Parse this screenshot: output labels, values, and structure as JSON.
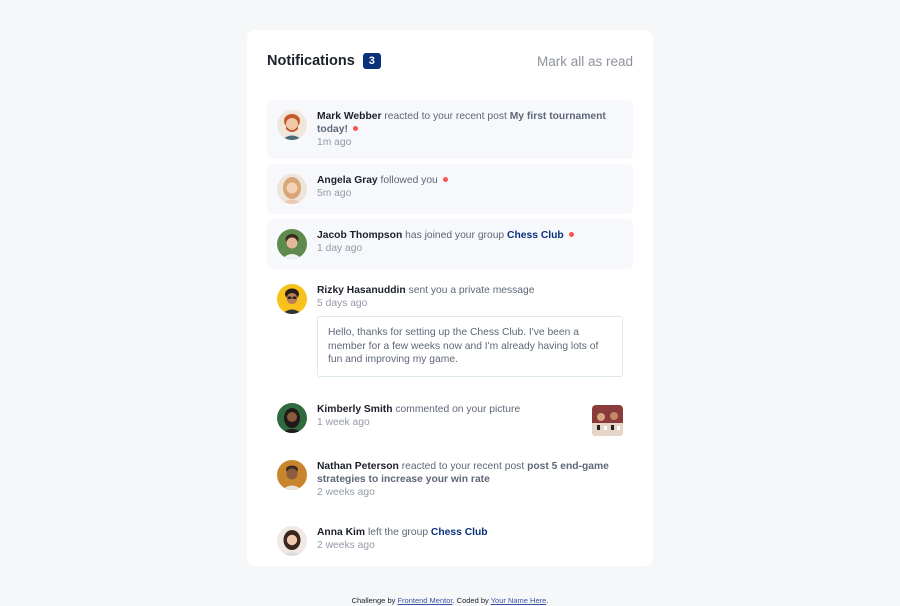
{
  "header": {
    "title": "Notifications",
    "count": "3",
    "mark_all_label": "Mark all as read"
  },
  "notifications": [
    {
      "actor": "Mark Webber",
      "action": "reacted to your recent post",
      "target": "My first tournament today!",
      "time": "1m ago",
      "unread": true
    },
    {
      "actor": "Angela Gray",
      "action": "followed you",
      "time": "5m ago",
      "unread": true
    },
    {
      "actor": "Jacob Thompson",
      "action": "has joined your group",
      "target": "Chess Club",
      "time": "1 day ago",
      "unread": true
    },
    {
      "actor": "Rizky Hasanuddin",
      "action": "sent you a private message",
      "time": "5 days ago",
      "message": "Hello, thanks for setting up the Chess Club. I've been a member for a few weeks now and I'm already having lots of fun and improving my game.",
      "unread": false
    },
    {
      "actor": "Kimberly Smith",
      "action": "commented on your picture",
      "time": "1 week ago",
      "unread": false
    },
    {
      "actor": "Nathan Peterson",
      "action": "reacted to your recent post",
      "target": "post 5 end-game strategies to increase your win rate",
      "time": "2 weeks ago",
      "unread": false
    },
    {
      "actor": "Anna Kim",
      "action": "left the group",
      "target": "Chess Club",
      "time": "2 weeks ago",
      "unread": false
    }
  ],
  "footer": {
    "prefix": "Challenge by",
    "link1": "Frontend Mentor",
    "middle": ". Coded by",
    "link2": "Your Name Here",
    "suffix": "."
  },
  "colors": {
    "accent": "#0a327b",
    "unread_dot": "#f65552",
    "unread_bg": "#f6f8fc"
  }
}
